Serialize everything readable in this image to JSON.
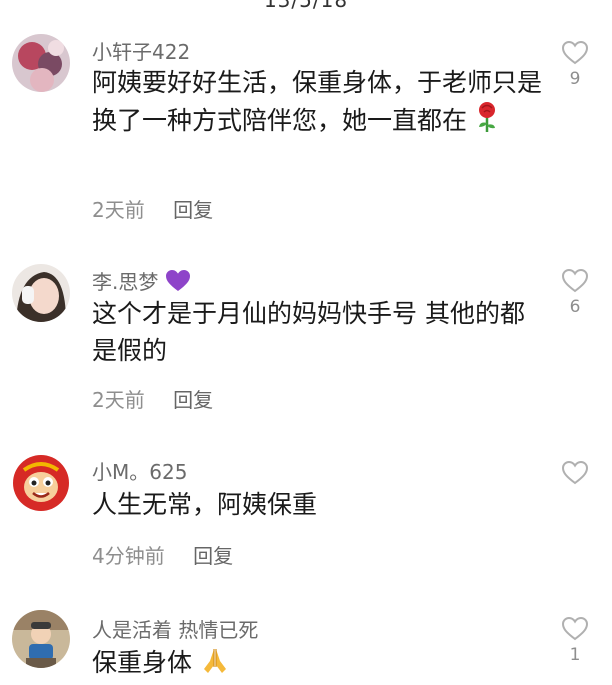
{
  "header": {
    "fragment": "13/5/18"
  },
  "comments": [
    {
      "username": "小轩子422",
      "text": "阿姨要好好生活，保重身体，于老师只是换了一种方式陪伴您，她一直都在",
      "time": "2天前",
      "reply_label": "回复",
      "like_count": "9",
      "emoji": "rose-emoji"
    },
    {
      "username": "李.思梦",
      "text": "这个才是于月仙的妈妈快手号 其他的都是假的",
      "time": "2天前",
      "reply_label": "回复",
      "like_count": "6",
      "emoji": "purple-heart-emoji"
    },
    {
      "username": "小M。625",
      "text": "人生无常，阿姨保重",
      "time": "4分钟前",
      "reply_label": "回复",
      "like_count": "",
      "emoji": ""
    },
    {
      "username": "人是活着 热情已死",
      "text": "保重身体",
      "time": "",
      "reply_label": "",
      "like_count": "1",
      "emoji": "praying-hands-emoji"
    }
  ],
  "colors": {
    "username": "#6b6b6b",
    "meta": "#8e8e8e",
    "text": "#1a1a1a",
    "heart_outline": "#b0b0b0"
  }
}
